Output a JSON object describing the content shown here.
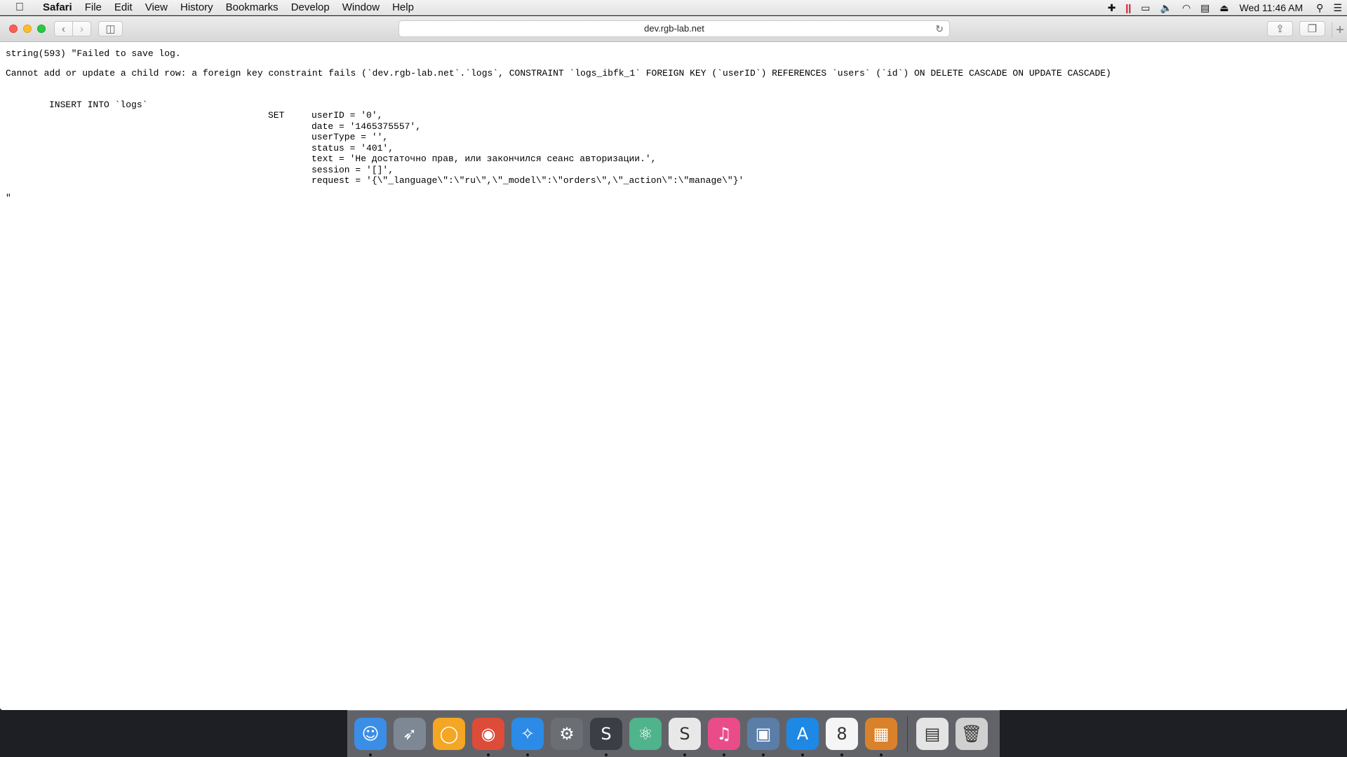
{
  "menubar": {
    "app_name": "Safari",
    "items": [
      "File",
      "Edit",
      "View",
      "History",
      "Bookmarks",
      "Develop",
      "Window",
      "Help"
    ],
    "clock": "Wed 11:46 AM"
  },
  "browser": {
    "url": "dev.rgb-lab.net"
  },
  "page": {
    "line1": "string(593) \"Failed to save log.",
    "line2": "Cannot add or update a child row: a foreign key constraint fails (`dev.rgb-lab.net`.`logs`, CONSTRAINT `logs_ibfk_1` FOREIGN KEY (`userID`) REFERENCES `users` (`id`) ON DELETE CASCADE ON UPDATE CASCADE)",
    "insert": "INSERT INTO `logs`",
    "set": "SET",
    "fields": [
      "userID = '0',",
      "date = '1465375557',",
      "userType = '',",
      "status = '401',",
      "text = 'Не достаточно прав, или закончился сеанс авторизации.',",
      "session = '[]',",
      "request = '{\\\"_language\\\":\\\"ru\\\",\\\"_model\\\":\\\"orders\\\",\\\"_action\\\":\\\"manage\\\"}'"
    ],
    "end": "\""
  },
  "dock": {
    "apps": [
      {
        "name": "finder-icon",
        "glyph": "☺",
        "color": "#3a8ee6",
        "running": true
      },
      {
        "name": "launchpad-icon",
        "glyph": "➶",
        "color": "#7d8894",
        "running": false
      },
      {
        "name": "chromium-icon",
        "glyph": "◯",
        "color": "#f5a623",
        "running": false
      },
      {
        "name": "chrome-icon",
        "glyph": "◉",
        "color": "#dd4b39",
        "running": true
      },
      {
        "name": "safari-icon",
        "glyph": "✧",
        "color": "#2b8be6",
        "running": true
      },
      {
        "name": "system-preferences-icon",
        "glyph": "⚙",
        "color": "#6b6e73",
        "running": false
      },
      {
        "name": "sublime-text-icon",
        "glyph": "S",
        "color": "#3b3f45",
        "running": true
      },
      {
        "name": "atom-icon",
        "glyph": "⚛",
        "color": "#4fb38b",
        "running": false
      },
      {
        "name": "slack-icon",
        "glyph": "S",
        "color": "#e8e8e8",
        "running": true
      },
      {
        "name": "itunes-icon",
        "glyph": "♫",
        "color": "#ea4c89",
        "running": true
      },
      {
        "name": "remote-desktop-icon",
        "glyph": "▣",
        "color": "#5a7ea8",
        "running": true
      },
      {
        "name": "app-store-icon",
        "glyph": "A",
        "color": "#1e88e5",
        "running": true
      },
      {
        "name": "calendar-icon",
        "glyph": "8",
        "color": "#f5f5f5",
        "running": true
      },
      {
        "name": "calculator-icon",
        "glyph": "▦",
        "color": "#d9822b",
        "running": true
      }
    ],
    "others": [
      {
        "name": "downloads-stack-icon",
        "glyph": "▤",
        "color": "#e4e4e4"
      },
      {
        "name": "trash-icon",
        "glyph": "🗑",
        "color": "#d0d0d0"
      }
    ]
  }
}
